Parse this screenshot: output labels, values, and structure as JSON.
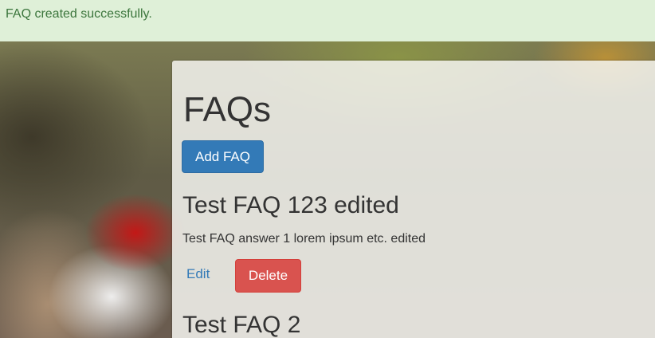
{
  "flash": {
    "message": "FAQ created successfully."
  },
  "page": {
    "title": "FAQs",
    "add_button_label": "Add FAQ"
  },
  "faqs": [
    {
      "title": "Test FAQ 123 edited",
      "answer": "Test FAQ answer 1 lorem ipsum etc. edited",
      "edit_label": "Edit",
      "delete_label": "Delete"
    },
    {
      "title": "Test FAQ 2"
    }
  ],
  "colors": {
    "flash_bg": "#dff0d8",
    "flash_text": "#3c763d",
    "primary": "#337ab7",
    "danger": "#d9534f"
  }
}
